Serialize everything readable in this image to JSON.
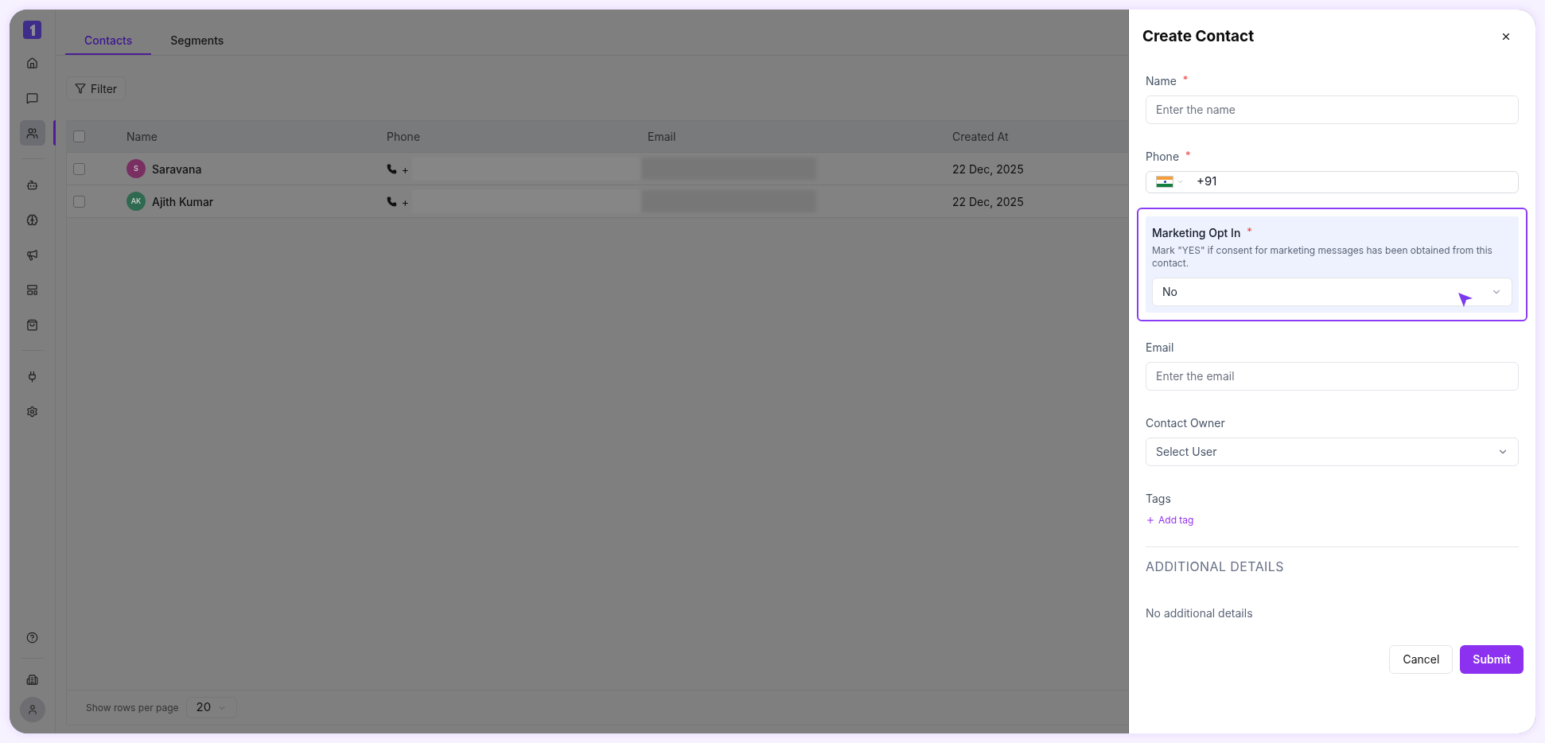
{
  "sidebar": {
    "groups": [
      {
        "items": [
          {
            "selected": false
          },
          {
            "selected": false
          },
          {
            "selected": true
          }
        ]
      },
      {
        "items": [
          {
            "selected": false
          },
          {
            "selected": false
          },
          {
            "selected": false
          },
          {
            "selected": false
          },
          {
            "selected": false
          }
        ]
      },
      {
        "items": [
          {
            "selected": false
          },
          {
            "selected": false
          }
        ]
      }
    ],
    "bottom": [
      {
        "selected": false
      },
      {
        "selected": false
      }
    ]
  },
  "tabs": [
    {
      "label": "Contacts",
      "selected": true
    },
    {
      "label": "Segments",
      "selected": false
    }
  ],
  "filter_button": "Filter",
  "table": {
    "header_checked": false,
    "columns": [
      "Name",
      "Phone",
      "Email",
      "Created At"
    ],
    "rows": [
      {
        "checked": false,
        "initials": "S",
        "color": "#7a2f63",
        "name": "Saravana",
        "phone": "+",
        "created_at": "22 Dec, 2025"
      },
      {
        "checked": false,
        "initials": "AK",
        "color": "#2f6a50",
        "name": "Ajith Kumar",
        "phone": "+",
        "created_at": "22 Dec, 2025"
      }
    ]
  },
  "pagination": {
    "label": "Show rows per page",
    "value": "20"
  },
  "panel": {
    "title": "Create Contact",
    "fields": [
      {
        "kind": "text",
        "label": "Name",
        "required_mark": "*",
        "placeholder": "Enter the name"
      },
      {
        "kind": "phone",
        "label": "Phone",
        "required_mark": "*",
        "value": "+91"
      },
      {
        "kind": "highlight_select",
        "label": "Marketing Opt In",
        "required_mark": "*",
        "help": "Mark \"YES\" if consent for marketing messages has been obtained from this contact.",
        "value": "No"
      },
      {
        "kind": "text",
        "label": "Email",
        "placeholder": "Enter the email"
      },
      {
        "kind": "select",
        "label": "Contact Owner",
        "placeholder": "Select User"
      },
      {
        "kind": "tags",
        "label": "Tags",
        "action": "Add tag"
      }
    ],
    "section_title": "ADDITIONAL DETAILS",
    "section_empty": "No additional details",
    "buttons": [
      {
        "kind": "secondary",
        "label": "Cancel"
      },
      {
        "kind": "primary",
        "label": "Submit"
      }
    ]
  }
}
